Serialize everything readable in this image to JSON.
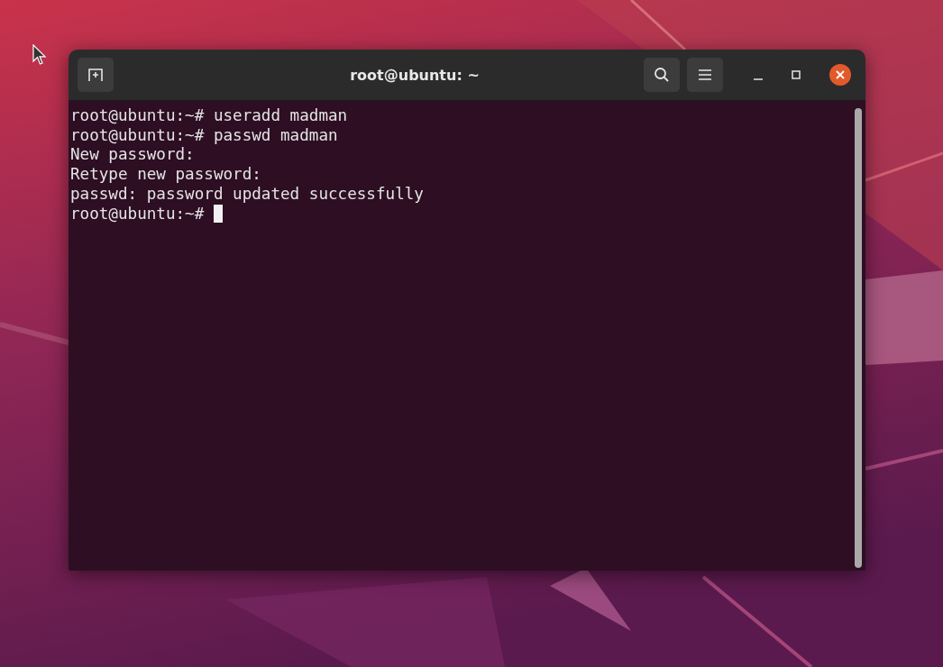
{
  "window": {
    "title": "root@ubuntu: ~"
  },
  "terminal": {
    "lines": [
      "root@ubuntu:~# useradd madman",
      "root@ubuntu:~# passwd madman",
      "New password:",
      "Retype new password:",
      "passwd: password updated successfully"
    ],
    "prompt": "root@ubuntu:~#",
    "cursor": true
  }
}
